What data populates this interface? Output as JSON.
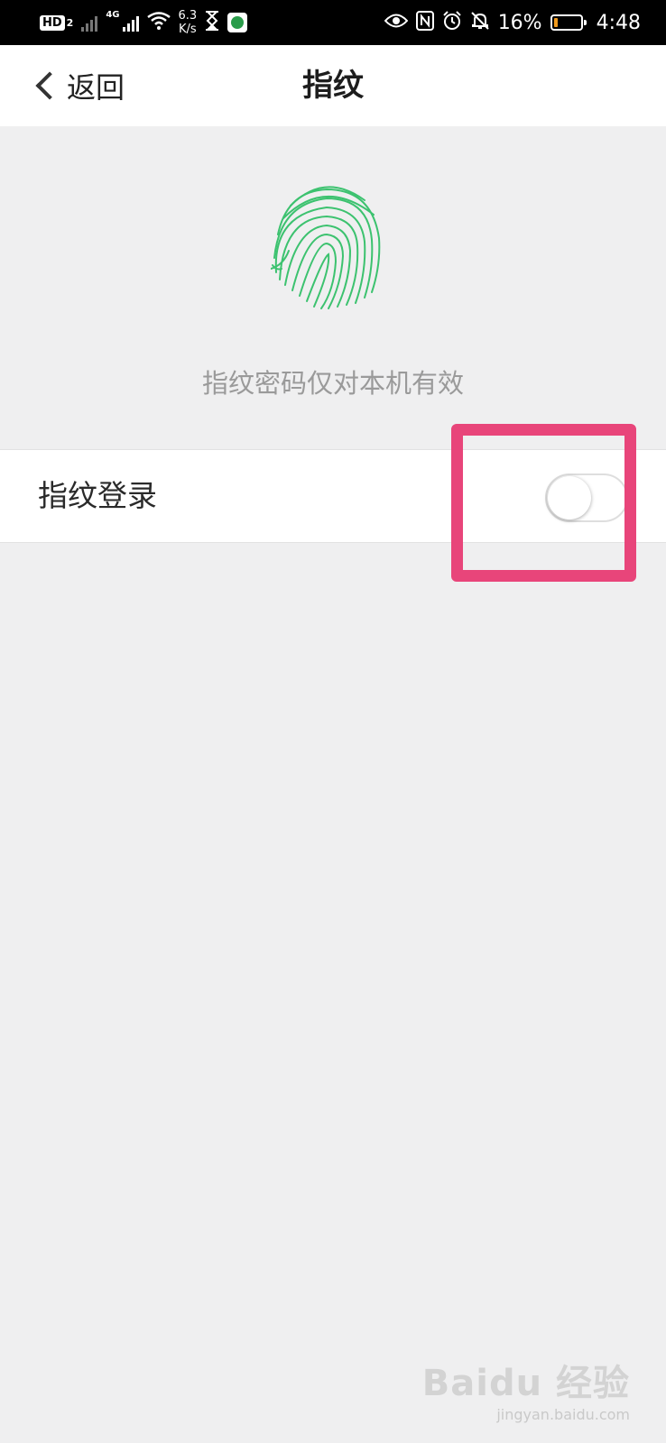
{
  "status_bar": {
    "network_badge": "HD",
    "network_badge_sub": "2",
    "net_type": "4G",
    "speed_value": "6.3",
    "speed_unit": "K/s",
    "battery_percent": "16%",
    "battery_level": 0.16,
    "battery_color": "#f29b1d",
    "time": "4:48",
    "icons": [
      "eye-icon",
      "nfc-icon",
      "alarm-icon",
      "bell-off-icon"
    ]
  },
  "nav": {
    "back_label": "返回",
    "title": "指纹"
  },
  "fingerprint": {
    "icon": "fingerprint-icon",
    "color": "#3cc26f",
    "hint": "指纹密码仅对本机有效"
  },
  "settings": {
    "fingerprint_login_label": "指纹登录",
    "fingerprint_login_enabled": false
  },
  "annotation": {
    "highlight_color": "#e8457a"
  },
  "watermark": {
    "logo": "Baidu 经验",
    "url": "jingyan.baidu.com"
  }
}
